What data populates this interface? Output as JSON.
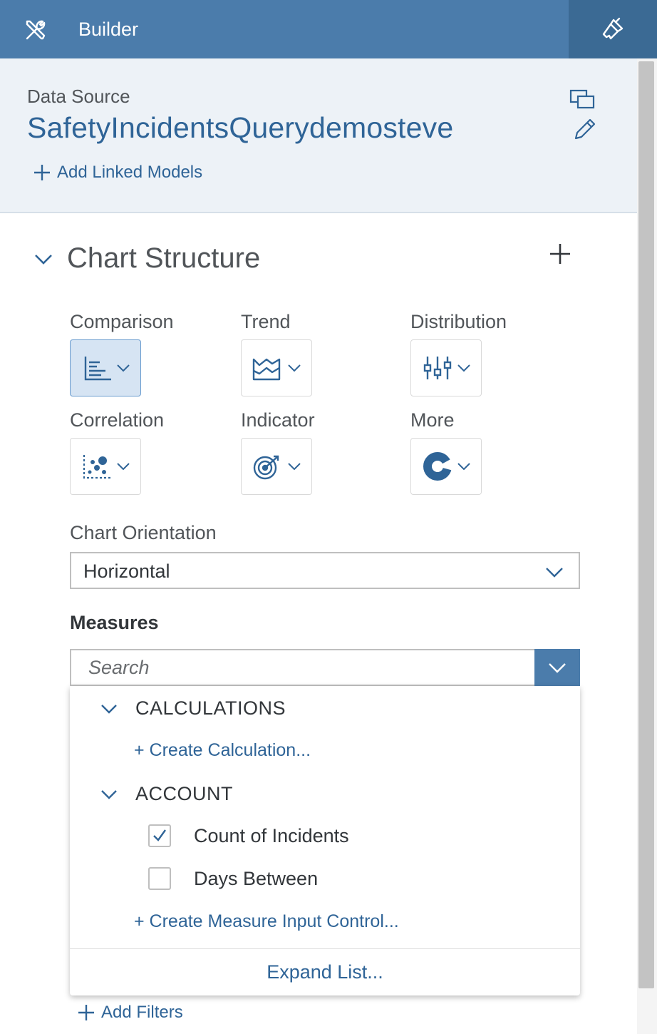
{
  "header": {
    "title": "Builder",
    "tools_icon": "tools-icon",
    "styling_icon": "paint-brush-icon",
    "colors": {
      "bar": "#4b7cab",
      "active_tab": "#3b6a94"
    }
  },
  "data_source": {
    "label": "Data Source",
    "name": "SafetyIncidentsQuerydemosteve",
    "add_linked_models": "Add Linked Models",
    "icons": [
      "linked-windows-icon",
      "pencil-icon"
    ]
  },
  "chart_structure": {
    "title": "Chart Structure",
    "categories": [
      {
        "label": "Comparison",
        "icon": "bar-chart-icon",
        "selected": true
      },
      {
        "label": "Trend",
        "icon": "area-chart-icon",
        "selected": false
      },
      {
        "label": "Distribution",
        "icon": "boxplot-icon",
        "selected": false
      },
      {
        "label": "Correlation",
        "icon": "scatter-icon",
        "selected": false
      },
      {
        "label": "Indicator",
        "icon": "target-icon",
        "selected": false
      },
      {
        "label": "More",
        "icon": "donut-icon",
        "selected": false
      }
    ],
    "orientation_label": "Chart Orientation",
    "orientation_value": "Horizontal"
  },
  "measures": {
    "label": "Measures",
    "search_placeholder": "Search",
    "groups": [
      {
        "name": "CALCULATIONS",
        "link": "+ Create Calculation..."
      },
      {
        "name": "ACCOUNT",
        "items": [
          {
            "label": "Count of Incidents",
            "checked": true
          },
          {
            "label": "Days Between",
            "checked": false
          }
        ],
        "link": "+ Create Measure Input Control..."
      }
    ],
    "expand_list": "Expand List..."
  },
  "add_filters": "Add Filters"
}
